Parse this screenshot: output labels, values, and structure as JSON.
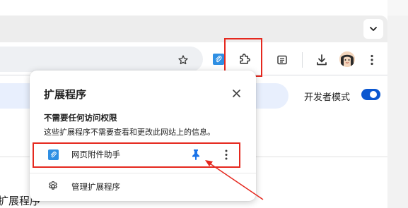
{
  "toolbar": {
    "icons": [
      "star-icon",
      "extension-pinned-icon",
      "puzzle-icon",
      "reading-list-icon",
      "download-icon",
      "avatar",
      "kebab-menu-icon"
    ],
    "tab_menu_icon": "chevron-down-icon"
  },
  "page": {
    "developer_mode_label": "开发者模式",
    "developer_mode_on": true,
    "heading_partial": "扩展程序"
  },
  "popup": {
    "title": "扩展程序",
    "section_title": "不需要任何访问权限",
    "section_description": "这些扩展程序不需要查看和更改此网站上的信息。",
    "extensions": [
      {
        "name": "网页附件助手",
        "pinned": true
      }
    ],
    "manage_label": "管理扩展程序"
  },
  "annotations": {
    "highlight_color": "#e5281e"
  },
  "colors": {
    "accent": "#0b57d0",
    "extension_icon": "#2f8fe3"
  }
}
